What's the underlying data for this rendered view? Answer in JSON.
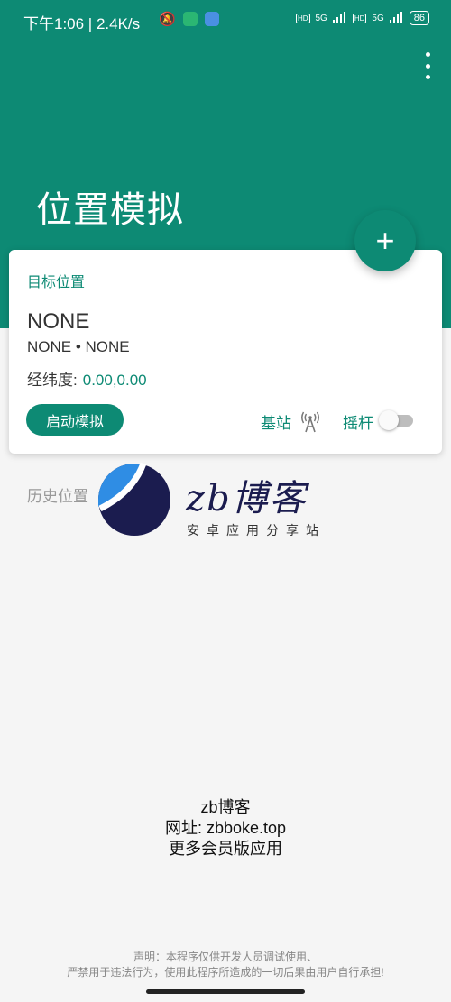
{
  "status_bar": {
    "time_speed": "下午1:06 | 2.4K/s",
    "network_1": "5G",
    "network_2": "5G",
    "battery": "86"
  },
  "header": {
    "title": "位置模拟"
  },
  "fab": {
    "icon": "+"
  },
  "card": {
    "label": "目标位置",
    "location_name": "NONE",
    "location_sub": "NONE • NONE",
    "coords_label": "经纬度:",
    "coords_value": "0.00,0.00",
    "start_button": "启动模拟",
    "station_label": "基站",
    "joystick_label": "摇杆",
    "joystick_on": false
  },
  "history": {
    "label": "历史位置"
  },
  "watermark": {
    "title": "zb博客",
    "subtitle": "安卓应用分享站"
  },
  "promo": {
    "line1": "zb博客",
    "line2": "网址: zbboke.top",
    "line3": "更多会员版应用"
  },
  "disclaimer": {
    "line1": "声明：本程序仅供开发人员调试使用、",
    "line2": "严禁用于违法行为，使用此程序所造成的一切后果由用户自行承担!"
  },
  "colors": {
    "primary": "#0d8a74",
    "background": "#f5f5f5"
  }
}
